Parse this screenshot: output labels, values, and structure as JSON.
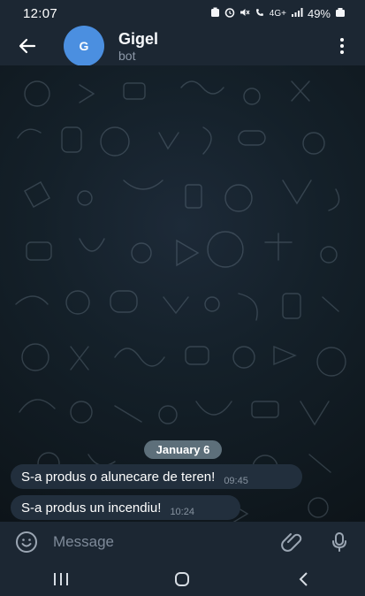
{
  "status": {
    "time": "12:07",
    "network": "4G+",
    "battery": "49%",
    "icons": [
      "battery-saver-icon",
      "alarm-icon",
      "mute-icon",
      "wifi-call-icon",
      "network-icon",
      "signal-icon",
      "battery-icon"
    ]
  },
  "header": {
    "back_icon": "arrow-left-icon",
    "avatar_initial": "G",
    "title": "Gigel",
    "subtitle": "bot",
    "menu_icon": "vertical-dots-icon"
  },
  "chat": {
    "date": "January 6",
    "messages": [
      {
        "text": "S-a produs o alunecare de teren!",
        "time": "09:45"
      },
      {
        "text": "S-a produs un incendiu!",
        "time": "10:24"
      }
    ]
  },
  "composer": {
    "placeholder": "Message",
    "emoji_icon": "emoji-icon",
    "attach_icon": "paperclip-icon",
    "mic_icon": "microphone-icon"
  },
  "navigation": [
    "recents-icon",
    "home-icon",
    "back-icon"
  ],
  "colors": {
    "bar": "#1c2733",
    "bubble": "#222f3d",
    "accent": "#4b8fe0",
    "date_pill": "#5d6f7a"
  }
}
